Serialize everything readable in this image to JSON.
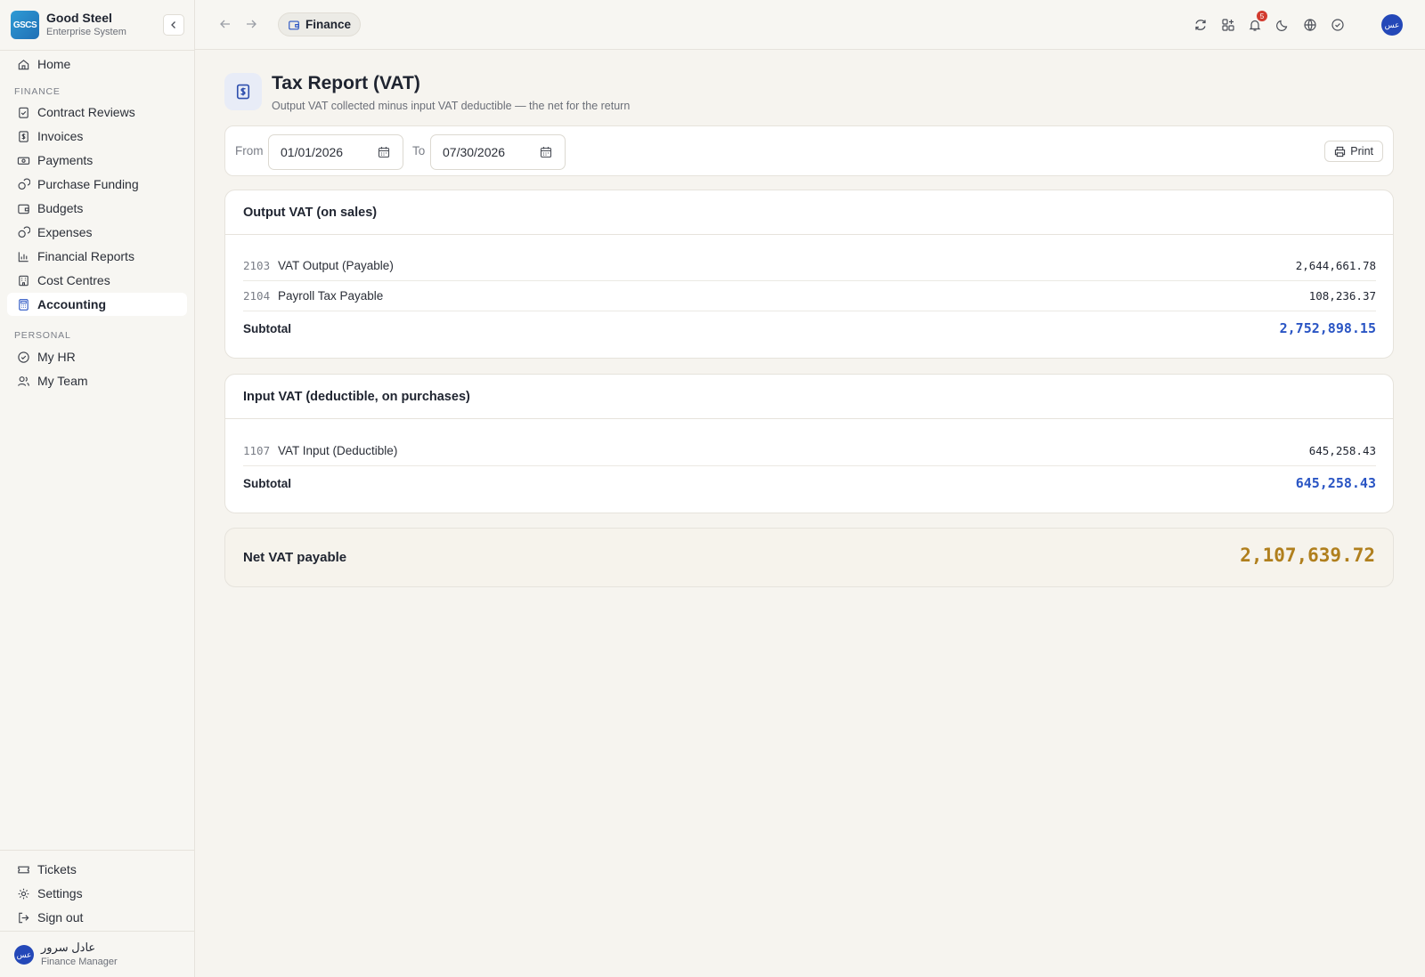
{
  "brand": {
    "logo_text": "GSCS",
    "name": "Good Steel",
    "subtitle": "Enterprise System"
  },
  "sidebar": {
    "home": "Home",
    "finance_section": "FINANCE",
    "finance_items": [
      {
        "label": "Contract Reviews",
        "icon": "clipboard-check-icon"
      },
      {
        "label": "Invoices",
        "icon": "invoice-dollar-icon"
      },
      {
        "label": "Payments",
        "icon": "banknote-icon"
      },
      {
        "label": "Purchase Funding",
        "icon": "coins-icon"
      },
      {
        "label": "Budgets",
        "icon": "wallet-icon"
      },
      {
        "label": "Expenses",
        "icon": "coins-icon"
      },
      {
        "label": "Financial Reports",
        "icon": "bar-chart-icon"
      },
      {
        "label": "Cost Centres",
        "icon": "building-icon"
      },
      {
        "label": "Accounting",
        "icon": "calculator-icon",
        "active": true
      }
    ],
    "personal_section": "PERSONAL",
    "personal_items": [
      {
        "label": "My HR",
        "icon": "check-circle-icon"
      },
      {
        "label": "My Team",
        "icon": "users-icon"
      }
    ],
    "bottom_items": [
      {
        "label": "Tickets",
        "icon": "ticket-icon"
      },
      {
        "label": "Settings",
        "icon": "gear-icon"
      },
      {
        "label": "Sign out",
        "icon": "sign-out-icon"
      }
    ],
    "user": {
      "avatar_text": "عس",
      "name": "عادل سرور",
      "role": "Finance Manager"
    }
  },
  "topbar": {
    "breadcrumb": "Finance",
    "notification_count": "5",
    "avatar_text": "عس"
  },
  "page": {
    "title": "Tax Report (VAT)",
    "subtitle": "Output VAT collected minus input VAT deductible — the net for the return"
  },
  "filters": {
    "from_label": "From",
    "from_value": "01/01/2026",
    "to_label": "To",
    "to_value": "07/30/2026",
    "print_label": "Print"
  },
  "output_vat": {
    "title": "Output VAT (on sales)",
    "rows": [
      {
        "code": "2103",
        "account": "VAT Output (Payable)",
        "amount": "2,644,661.78"
      },
      {
        "code": "2104",
        "account": "Payroll Tax Payable",
        "amount": "108,236.37"
      }
    ],
    "subtotal_label": "Subtotal",
    "subtotal": "2,752,898.15"
  },
  "input_vat": {
    "title": "Input VAT (deductible, on purchases)",
    "rows": [
      {
        "code": "1107",
        "account": "VAT Input (Deductible)",
        "amount": "645,258.43"
      }
    ],
    "subtotal_label": "Subtotal",
    "subtotal": "645,258.43"
  },
  "net": {
    "label": "Net VAT payable",
    "amount": "2,107,639.72"
  },
  "colors": {
    "accent": "#2a55c4",
    "net_amount": "#b07f1d",
    "badge": "#d23b2f"
  }
}
